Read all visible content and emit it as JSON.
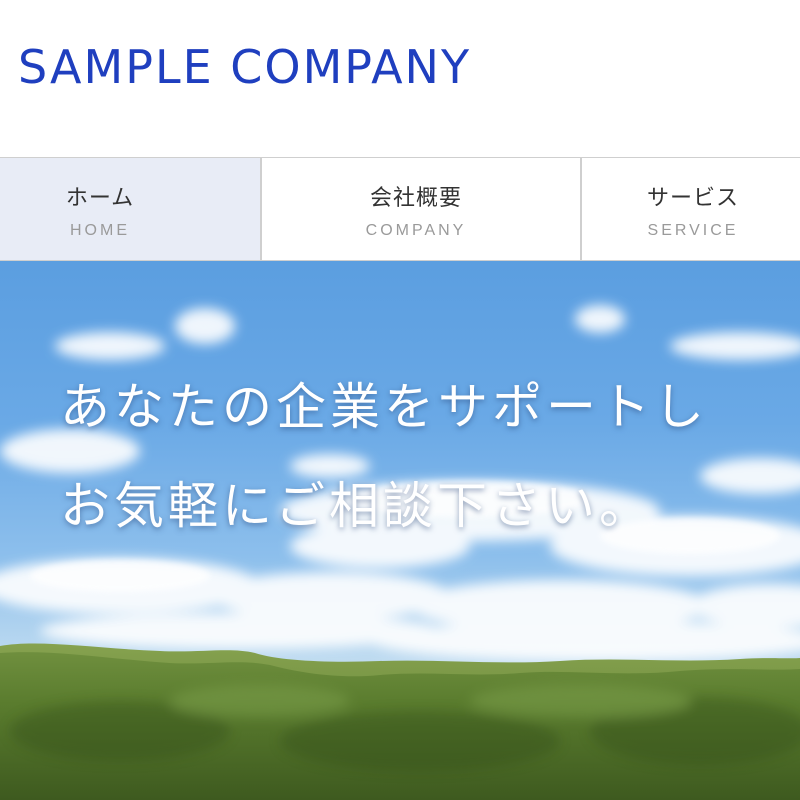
{
  "header": {
    "logo_text": "SAMPLE COMPANY",
    "brand_color": "#1f3fbf"
  },
  "nav": {
    "items": [
      {
        "label_jp": "ホーム",
        "label_en": "HOME",
        "active": true
      },
      {
        "label_jp": "会社概要",
        "label_en": "COMPANY",
        "active": false
      },
      {
        "label_jp": "サービス",
        "label_en": "SERVICE",
        "active": false
      }
    ],
    "active_bg": "#e8ecf6"
  },
  "hero": {
    "catch_line1": "あなたの企業をサポートし",
    "catch_line2": "お気軽にご相談下さい。"
  }
}
